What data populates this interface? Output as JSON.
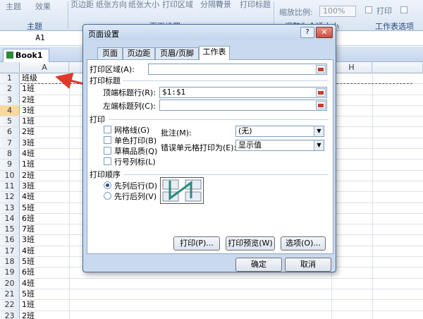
{
  "ribbon": {
    "items": [
      "主题",
      "效果",
      "页边距",
      "纸张方向",
      "纸张大小",
      "打印区域",
      "分隔符",
      "背景",
      "打印标题"
    ],
    "zoom_label": "缩放比例:",
    "zoom_value": "100%",
    "print_label": "打印",
    "groups": [
      "主题",
      "页面设置",
      "调整为合适大小",
      "工作表选项"
    ]
  },
  "namebox": {
    "value": "A1"
  },
  "workbook": {
    "tab_label": "Book1 *"
  },
  "grid": {
    "columns": [
      "A",
      "H"
    ],
    "rows": [
      {
        "num": "1",
        "a": "班级"
      },
      {
        "num": "2",
        "a": "1班"
      },
      {
        "num": "3",
        "a": "2班"
      },
      {
        "num": "4",
        "a": "3班"
      },
      {
        "num": "5",
        "a": "1班"
      },
      {
        "num": "6",
        "a": "2班"
      },
      {
        "num": "7",
        "a": "3班"
      },
      {
        "num": "8",
        "a": "4班"
      },
      {
        "num": "9",
        "a": "1班"
      },
      {
        "num": "10",
        "a": "2班"
      },
      {
        "num": "11",
        "a": "3班"
      },
      {
        "num": "12",
        "a": "4班"
      },
      {
        "num": "13",
        "a": "5班"
      },
      {
        "num": "14",
        "a": "6班"
      },
      {
        "num": "15",
        "a": "7班"
      },
      {
        "num": "16",
        "a": "3班"
      },
      {
        "num": "17",
        "a": "4班"
      },
      {
        "num": "18",
        "a": "5班"
      },
      {
        "num": "19",
        "a": "6班"
      },
      {
        "num": "20",
        "a": "4班"
      },
      {
        "num": "21",
        "a": "5班"
      },
      {
        "num": "22",
        "a": "1班"
      },
      {
        "num": "23",
        "a": "2班"
      }
    ]
  },
  "dialog": {
    "title": "页面设置",
    "help": "?",
    "close": "✕",
    "tabs": [
      "页面",
      "页边距",
      "页眉/页脚",
      "工作表"
    ],
    "print_area_label": "打印区域(A):",
    "print_titles_label": "打印标题",
    "top_rows_label": "顶端标题行(R):",
    "top_rows_value": "$1:$1",
    "left_cols_label": "左端标题列(C):",
    "print_section_label": "打印",
    "checkboxes": [
      "网格线(G)",
      "单色打印(B)",
      "草稿品质(Q)",
      "行号列标(L)"
    ],
    "comments_label": "批注(M):",
    "comments_value": "(无)",
    "errors_label": "错误单元格打印为(E):",
    "errors_value": "显示值",
    "page_order_label": "打印顺序",
    "radio_down_then_over": "先列后行(D)",
    "radio_over_then_down": "先行后列(V)",
    "btn_print": "打印(P)...",
    "btn_preview": "打印预览(W)",
    "btn_options": "选项(O)...",
    "btn_ok": "确定",
    "btn_cancel": "取消"
  },
  "colors": {
    "selected_row_header": "#f9d99a",
    "close_button": "#c8503f",
    "annotation_arrow": "#e0392b"
  }
}
